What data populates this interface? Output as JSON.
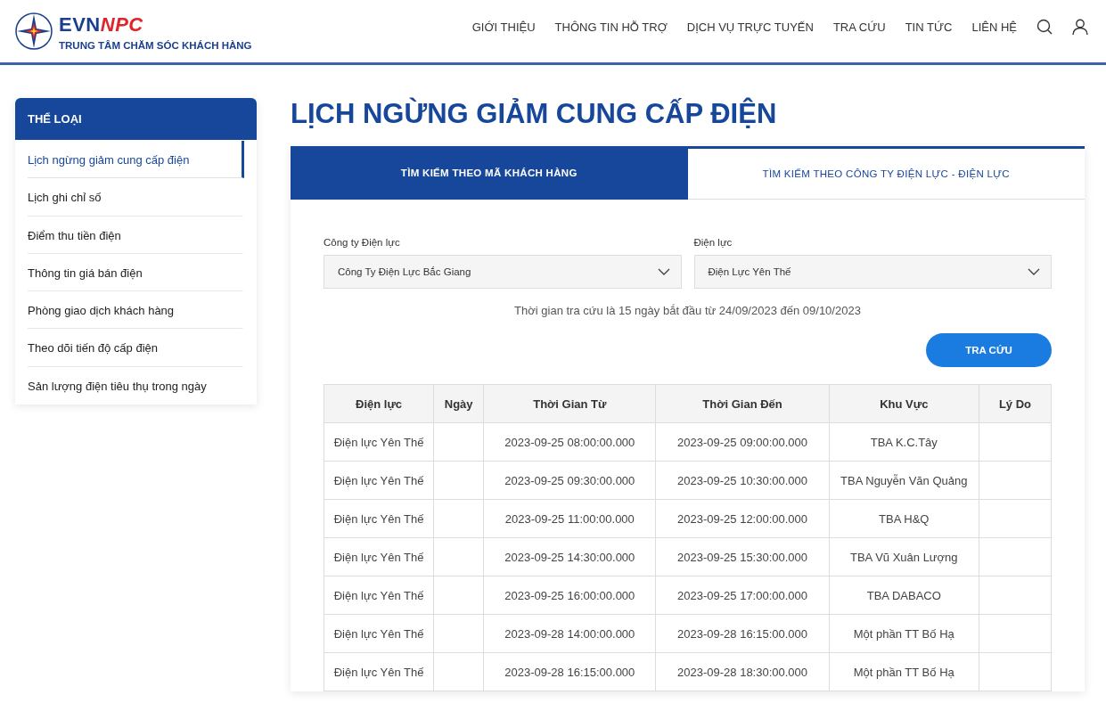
{
  "header": {
    "brand": {
      "evn": "EVN",
      "npc": "NPC",
      "subtitle": "TRUNG TÂM CHĂM SÓC KHÁCH HÀNG"
    },
    "nav": [
      "GIỚI THIỆU",
      "THÔNG TIN HỖ TRỢ",
      "DỊCH VỤ TRỰC TUYẾN",
      "TRA CỨU",
      "TIN TỨC",
      "LIÊN HỆ"
    ]
  },
  "sidebar": {
    "title": "THỂ LOẠI",
    "items": [
      {
        "label": "Lịch ngừng giảm cung cấp điện",
        "selected": true
      },
      {
        "label": "Lịch ghi chỉ số",
        "selected": false
      },
      {
        "label": "Điểm thu tiền điện",
        "selected": false
      },
      {
        "label": "Thông tin giá bán điện",
        "selected": false
      },
      {
        "label": "Phòng giao dịch khách hàng",
        "selected": false
      },
      {
        "label": "Theo dõi tiến độ cấp điện",
        "selected": false
      },
      {
        "label": "Sản lượng điện tiêu thụ trong ngày",
        "selected": false
      }
    ]
  },
  "page_title": "LỊCH NGỪNG GIẢM CUNG CẤP ĐIỆN",
  "tabs": [
    {
      "label": "TÌM KIẾM THEO MÃ KHÁCH HÀNG",
      "selected": true
    },
    {
      "label": "TÌM KIẾM THEO CÔNG TY ĐIỆN LỰC - ĐIỆN LỰC",
      "selected": false
    }
  ],
  "form": {
    "fields": [
      {
        "label": "Công ty Điện lực",
        "value": "Công Ty Điện Lực Bắc Giang"
      },
      {
        "label": "Điện lực",
        "value": "Điện Lực Yên Thế"
      }
    ],
    "note": "Thời gian tra cứu là 15 ngày bắt đầu từ 24/09/2023 đến 09/10/2023",
    "button": "TRA CỨU"
  },
  "table": {
    "columns": [
      "Điện lực",
      "Ngày",
      "Thời Gian Từ",
      "Thời Gian Đến",
      "Khu Vực",
      "Lý Do"
    ],
    "rows": [
      [
        "Điện lực Yên Thế",
        "",
        "2023-09-25 08:00:00.000",
        "2023-09-25 09:00:00.000",
        "TBA K.C.Tây",
        ""
      ],
      [
        "Điện lực Yên Thế",
        "",
        "2023-09-25 09:30:00.000",
        "2023-09-25 10:30:00.000",
        "TBA Nguyễn Văn Quảng",
        ""
      ],
      [
        "Điện lực Yên Thế",
        "",
        "2023-09-25 11:00:00.000",
        "2023-09-25 12:00:00.000",
        "TBA H&Q",
        ""
      ],
      [
        "Điện lực Yên Thế",
        "",
        "2023-09-25 14:30:00.000",
        "2023-09-25 15:30:00.000",
        "TBA Vũ Xuân Lượng",
        ""
      ],
      [
        "Điện lực Yên Thế",
        "",
        "2023-09-25 16:00:00.000",
        "2023-09-25 17:00:00.000",
        "TBA DABACO",
        ""
      ],
      [
        "Điện lực Yên Thế",
        "",
        "2023-09-28 14:00:00.000",
        "2023-09-28 16:15:00.000",
        "Một phần TT Bố Hạ",
        ""
      ],
      [
        "Điện lực Yên Thế",
        "",
        "2023-09-28 16:15:00.000",
        "2023-09-28 18:30:00.000",
        "Một phần TT Bố Hạ",
        ""
      ]
    ]
  }
}
